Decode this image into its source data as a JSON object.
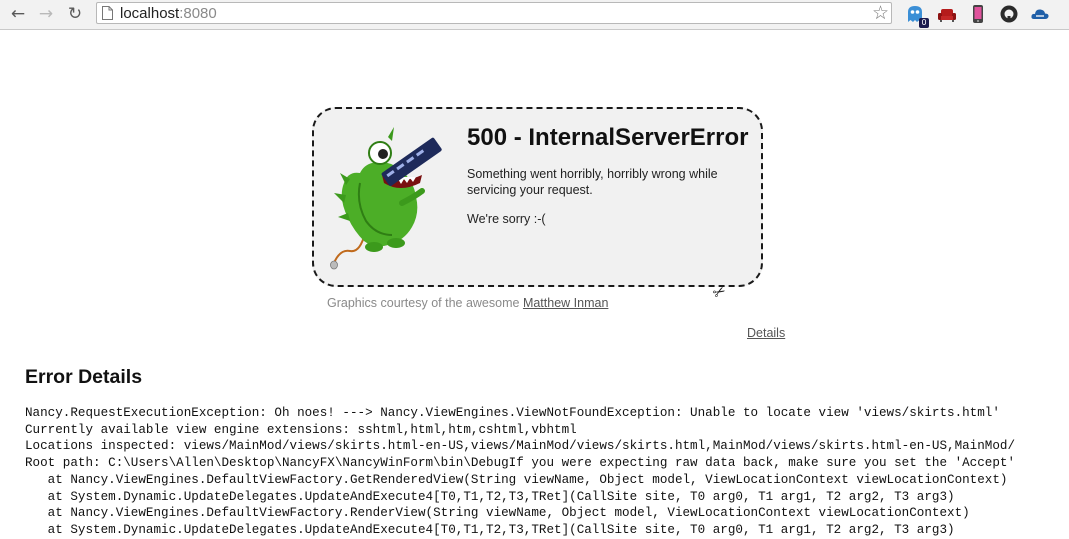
{
  "browser": {
    "url_host": "localhost",
    "url_port": ":8080",
    "back_icon": "←",
    "forward_icon": "→",
    "reload_icon": "↻",
    "star_icon": "☆",
    "extension_badge": "0",
    "extensions": [
      "ghost-extension-icon",
      "couch-extension-icon",
      "phone-extension-icon",
      "github-extension-icon",
      "cloud-extension-icon"
    ]
  },
  "error": {
    "title": "500 - InternalServerError",
    "message": "Something went horribly, horribly wrong while servicing your request.",
    "sorry": "We're sorry :-(",
    "scissors_icon": "✂",
    "credit_prefix": "Graphics courtesy of the awesome ",
    "credit_link": "Matthew Inman",
    "details_link": "Details"
  },
  "error_details": {
    "heading": "Error Details",
    "lines": [
      "Nancy.RequestExecutionException: Oh noes! ---> Nancy.ViewEngines.ViewNotFoundException: Unable to locate view 'views/skirts.html'",
      "Currently available view engine extensions: sshtml,html,htm,cshtml,vbhtml",
      "Locations inspected: views/MainMod/views/skirts.html-en-US,views/MainMod/views/skirts.html,MainMod/views/skirts.html-en-US,MainMod/",
      "Root path: C:\\Users\\Allen\\Desktop\\NancyFX\\NancyWinForm\\bin\\DebugIf you were expecting raw data back, make sure you set the 'Accept'",
      "   at Nancy.ViewEngines.DefaultViewFactory.GetRenderedView(String viewName, Object model, ViewLocationContext viewLocationContext)",
      "   at System.Dynamic.UpdateDelegates.UpdateAndExecute4[T0,T1,T2,T3,TRet](CallSite site, T0 arg0, T1 arg1, T2 arg2, T3 arg3)",
      "   at Nancy.ViewEngines.DefaultViewFactory.RenderView(String viewName, Object model, ViewLocationContext viewLocationContext)",
      "   at System.Dynamic.UpdateDelegates.UpdateAndExecute4[T0,T1,T2,T3,TRet](CallSite site, T0 arg0, T1 arg1, T2 arg2, T3 arg3)"
    ]
  }
}
